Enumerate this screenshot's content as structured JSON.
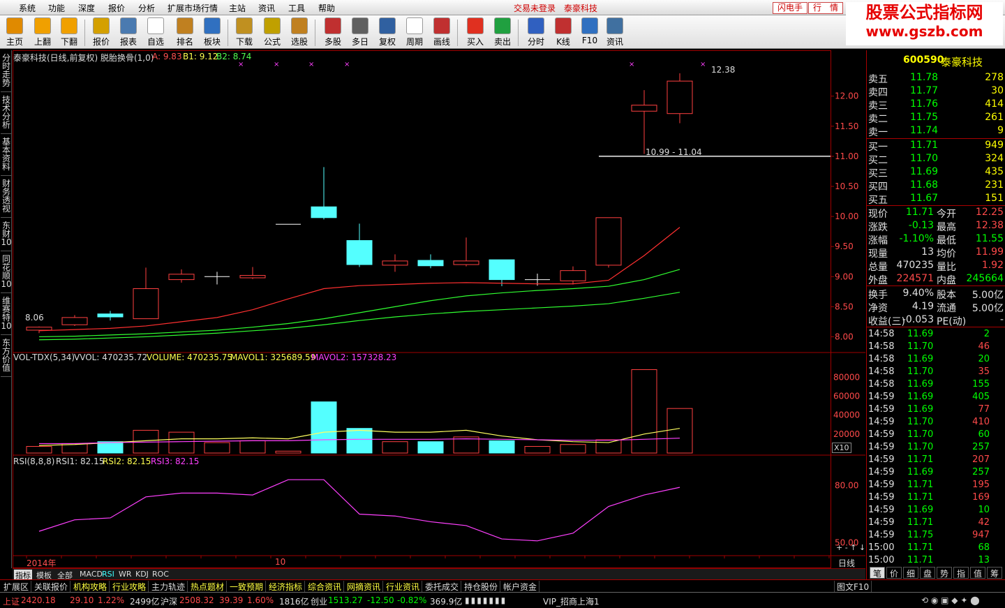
{
  "menu": {
    "items": [
      "系统",
      "功能",
      "深度",
      "报价",
      "分析",
      "扩展市场行情",
      "主站",
      "资讯",
      "工具",
      "帮助"
    ],
    "trade_status": "交易未登录",
    "stock_name": "泰豪科技",
    "btn_flash": "闪电手",
    "btn_quote": "行　情"
  },
  "logo": {
    "line1": "股票公式指标网",
    "line2": "www.gszb.com"
  },
  "toolbar": [
    {
      "label": "主页",
      "icon": "home-icon",
      "color": "#e08a00"
    },
    {
      "label": "上翻",
      "icon": "arrow-up-icon",
      "color": "#f0a000"
    },
    {
      "label": "下翻",
      "icon": "arrow-down-icon",
      "color": "#f0a000"
    },
    {
      "label": "报价",
      "icon": "yen-icon",
      "color": "#d4a000"
    },
    {
      "label": "报表",
      "icon": "report-icon",
      "color": "#4a7ab0"
    },
    {
      "label": "自选",
      "icon": "f6-icon",
      "color": "#ffffff"
    },
    {
      "label": "排名",
      "icon": "ranking-icon",
      "color": "#c08020"
    },
    {
      "label": "板块",
      "icon": "sector-icon",
      "color": "#3070c0"
    },
    {
      "label": "下载",
      "icon": "download-icon",
      "color": "#c09020"
    },
    {
      "label": "公式",
      "icon": "formula-icon",
      "color": "#c0a000"
    },
    {
      "label": "选股",
      "icon": "stock-pick-icon",
      "color": "#c08020"
    },
    {
      "label": "多股",
      "icon": "multi-stock-icon",
      "color": "#c03030"
    },
    {
      "label": "多日",
      "icon": "clock-icon",
      "color": "#606060"
    },
    {
      "label": "复权",
      "icon": "adjust-icon",
      "color": "#3060a0"
    },
    {
      "label": "周期",
      "icon": "f8-icon",
      "color": "#ffffff"
    },
    {
      "label": "画线",
      "icon": "draw-line-icon",
      "color": "#c03030"
    },
    {
      "label": "买入",
      "icon": "buy-icon",
      "color": "#e03020"
    },
    {
      "label": "卖出",
      "icon": "sell-icon",
      "color": "#20a040"
    },
    {
      "label": "分时",
      "icon": "intraday-icon",
      "color": "#3060c0"
    },
    {
      "label": "K线",
      "icon": "kline-icon",
      "color": "#c03030"
    },
    {
      "label": "F10",
      "icon": "f10-icon",
      "color": "#3070c0"
    },
    {
      "label": "资讯",
      "icon": "news-icon",
      "color": "#4070a0"
    }
  ],
  "left_tabs": [
    "分时走势",
    "技术分析",
    "基本资料",
    "财务透视",
    "东财10",
    "同花顺10",
    "维赛特10",
    "东方价值"
  ],
  "chart": {
    "title": "泰豪科技(日线,前复权) 脱胎换骨(1,0)",
    "ind_a": "A: 9.83",
    "ind_b1": "B1: 9.12",
    "ind_b2": "B2: 8.74",
    "high_label": "12.38",
    "low_label": "8.06",
    "gap_label": "10.99 - 11.04",
    "price_ticks": [
      "12.00",
      "11.50",
      "11.00",
      "10.50",
      "10.00",
      "9.50",
      "9.00",
      "8.50",
      "8.00"
    ],
    "vol_title": "VOL-TDX(5,34)",
    "vol_vvol": "VVOL: 470235.72",
    "vol_volume": "VOLUME: 470235.75",
    "vol_mavol1": "MAVOL1: 325689.59",
    "vol_mavol2": "MAVOL2: 157328.23",
    "vol_ticks": [
      "80000",
      "60000",
      "40000",
      "20000"
    ],
    "vol_unit": "X10",
    "rsi_title": "RSI(8,8,8)",
    "rsi1": "RSI1: 82.15",
    "rsi2": "RSI2: 82.15",
    "rsi3": "RSI3: 82.15",
    "rsi_ticks": [
      "80.00",
      "50.00"
    ],
    "date_year": "2014年",
    "date_month": "10",
    "period": "日线"
  },
  "chart_data": {
    "type": "candlestick",
    "candles": [
      {
        "o": 8.11,
        "c": 8.16,
        "h": 8.17,
        "l": 8.06
      },
      {
        "o": 8.2,
        "c": 8.32,
        "h": 8.36,
        "l": 8.18
      },
      {
        "o": 8.38,
        "c": 8.33,
        "h": 8.43,
        "l": 8.27
      },
      {
        "o": 8.3,
        "c": 8.8,
        "h": 9.15,
        "l": 8.3
      },
      {
        "o": 8.95,
        "c": 9.04,
        "h": 9.12,
        "l": 8.9
      },
      {
        "o": 9.0,
        "c": 9.0,
        "h": 9.08,
        "l": 8.87
      },
      {
        "o": 8.98,
        "c": 9.02,
        "h": 9.16,
        "l": 8.96
      },
      {
        "o": 9.87,
        "c": 9.87,
        "h": 9.87,
        "l": 9.87
      },
      {
        "o": 10.16,
        "c": 9.98,
        "h": 10.82,
        "l": 9.95
      },
      {
        "o": 9.6,
        "c": 9.2,
        "h": 9.88,
        "l": 9.16
      },
      {
        "o": 9.19,
        "c": 9.26,
        "h": 9.37,
        "l": 9.08
      },
      {
        "o": 9.27,
        "c": 9.18,
        "h": 9.37,
        "l": 9.14
      },
      {
        "o": 9.2,
        "c": 9.26,
        "h": 9.65,
        "l": 9.17
      },
      {
        "o": 9.28,
        "c": 8.95,
        "h": 9.28,
        "l": 8.84
      },
      {
        "o": 8.95,
        "c": 8.95,
        "h": 9.05,
        "l": 8.85
      },
      {
        "o": 8.93,
        "c": 9.1,
        "h": 9.17,
        "l": 8.87
      },
      {
        "o": 9.19,
        "c": 9.98,
        "h": 9.98,
        "l": 9.15
      },
      {
        "o": 11.75,
        "c": 11.85,
        "h": 12.1,
        "l": 11.04
      },
      {
        "o": 11.71,
        "c": 12.25,
        "h": 12.38,
        "l": 11.55
      }
    ],
    "volume": [
      7000,
      10000,
      12000,
      24000,
      22000,
      11000,
      13000,
      2000,
      54000,
      26000,
      12000,
      12000,
      17000,
      13000,
      7000,
      9000,
      14000,
      88000,
      47000
    ],
    "rsi": [
      56,
      62,
      63,
      74,
      76,
      76,
      75,
      83,
      83,
      65,
      64,
      61,
      59,
      52,
      51,
      55,
      69,
      75,
      79,
      82.15
    ],
    "y_range": [
      7.75,
      12.6
    ],
    "vol_range": [
      0,
      95000
    ],
    "rsi_range": [
      44,
      90
    ]
  },
  "quote": {
    "code": "600590",
    "name": "泰豪科技",
    "asks": [
      {
        "label": "卖五",
        "price": "11.78",
        "vol": "278"
      },
      {
        "label": "卖四",
        "price": "11.77",
        "vol": "30"
      },
      {
        "label": "卖三",
        "price": "11.76",
        "vol": "414"
      },
      {
        "label": "卖二",
        "price": "11.75",
        "vol": "261"
      },
      {
        "label": "卖一",
        "price": "11.74",
        "vol": "9"
      }
    ],
    "bids": [
      {
        "label": "买一",
        "price": "11.71",
        "vol": "949"
      },
      {
        "label": "买二",
        "price": "11.70",
        "vol": "324"
      },
      {
        "label": "买三",
        "price": "11.69",
        "vol": "435"
      },
      {
        "label": "买四",
        "price": "11.68",
        "vol": "231"
      },
      {
        "label": "买五",
        "price": "11.67",
        "vol": "151"
      }
    ],
    "stats": [
      {
        "l1": "现价",
        "v1": "11.71",
        "c1": "g",
        "l2": "今开",
        "v2": "12.25",
        "c2": "r"
      },
      {
        "l1": "涨跌",
        "v1": "-0.13",
        "c1": "g",
        "l2": "最高",
        "v2": "12.38",
        "c2": "r"
      },
      {
        "l1": "涨幅",
        "v1": "-1.10%",
        "c1": "g",
        "l2": "最低",
        "v2": "11.55",
        "c2": "g"
      },
      {
        "l1": "现量",
        "v1": "13",
        "c1": "w",
        "l2": "均价",
        "v2": "11.99",
        "c2": "r"
      },
      {
        "l1": "总量",
        "v1": "470235",
        "c1": "w",
        "l2": "量比",
        "v2": "1.92",
        "c2": "r"
      },
      {
        "l1": "外盘",
        "v1": "224571",
        "c1": "r",
        "l2": "内盘",
        "v2": "245664",
        "c2": "g"
      }
    ],
    "stats2": [
      {
        "l1": "换手",
        "v1": "9.40%",
        "c1": "w",
        "l2": "股本",
        "v2": "5.00亿",
        "c2": "w"
      },
      {
        "l1": "净资",
        "v1": "4.19",
        "c1": "w",
        "l2": "流通",
        "v2": "5.00亿",
        "c2": "w"
      },
      {
        "l1": "收益(三)",
        "v1": "-0.053",
        "c1": "w",
        "l2": "PE(动)",
        "v2": "-",
        "c2": "w"
      }
    ],
    "ticks": [
      {
        "t": "14:58",
        "p": "11.69",
        "v": "2",
        "vc": "g"
      },
      {
        "t": "14:58",
        "p": "11.70",
        "v": "46",
        "vc": "r"
      },
      {
        "t": "14:58",
        "p": "11.69",
        "v": "20",
        "vc": "g"
      },
      {
        "t": "14:58",
        "p": "11.70",
        "v": "35",
        "vc": "r"
      },
      {
        "t": "14:58",
        "p": "11.69",
        "v": "155",
        "vc": "g"
      },
      {
        "t": "14:59",
        "p": "11.69",
        "v": "405",
        "vc": "g"
      },
      {
        "t": "14:59",
        "p": "11.69",
        "v": "77",
        "vc": "r"
      },
      {
        "t": "14:59",
        "p": "11.70",
        "v": "410",
        "vc": "r"
      },
      {
        "t": "14:59",
        "p": "11.70",
        "v": "60",
        "vc": "g"
      },
      {
        "t": "14:59",
        "p": "11.70",
        "v": "257",
        "vc": "g"
      },
      {
        "t": "14:59",
        "p": "11.71",
        "v": "207",
        "vc": "r"
      },
      {
        "t": "14:59",
        "p": "11.69",
        "v": "257",
        "vc": "g"
      },
      {
        "t": "14:59",
        "p": "11.71",
        "v": "195",
        "vc": "r"
      },
      {
        "t": "14:59",
        "p": "11.71",
        "v": "169",
        "vc": "r"
      },
      {
        "t": "14:59",
        "p": "11.69",
        "v": "10",
        "vc": "g"
      },
      {
        "t": "14:59",
        "p": "11.71",
        "v": "42",
        "vc": "r"
      },
      {
        "t": "14:59",
        "p": "11.75",
        "v": "947",
        "vc": "r"
      },
      {
        "t": "15:00",
        "p": "11.71",
        "v": "68",
        "vc": "g"
      },
      {
        "t": "15:00",
        "p": "11.71",
        "v": "13",
        "vc": "g"
      }
    ],
    "tabs": [
      "笔",
      "价",
      "细",
      "盘",
      "势",
      "指",
      "值",
      "筹"
    ]
  },
  "bottom_tabs1": [
    "指标",
    "模板",
    "全部",
    "MACD",
    "RSI",
    "WR",
    "KDJ",
    "ROC"
  ],
  "bottom_tabs2": [
    {
      "label": "扩展区",
      "c": "w"
    },
    {
      "label": "关联报价",
      "c": "w"
    },
    {
      "label": "机构攻略",
      "c": "y"
    },
    {
      "label": "行业攻略",
      "c": "y"
    },
    {
      "label": "主力轨迹",
      "c": "w"
    },
    {
      "label": "热点题材",
      "c": "y"
    },
    {
      "label": "一致预期",
      "c": "y"
    },
    {
      "label": "经济指标",
      "c": "y"
    },
    {
      "label": "综合资讯",
      "c": "y"
    },
    {
      "label": "网摘资讯",
      "c": "y"
    },
    {
      "label": "行业资讯",
      "c": "y"
    },
    {
      "label": "委托成交",
      "c": "w"
    },
    {
      "label": "持仓股份",
      "c": "w"
    },
    {
      "label": "帐户资金",
      "c": "w"
    }
  ],
  "f10_label": "图文F10",
  "status": {
    "sh_label": "上证",
    "sh_val": "2420.18",
    "sh_chg": "29.10",
    "sh_pct": "1.22%",
    "sh_amt": "2499亿",
    "sz_label": "沪深",
    "sz_val": "2508.32",
    "sz_chg": "39.39",
    "sz_pct": "1.60%",
    "sz_amt": "1816亿",
    "cy_label": "创业",
    "cy_val": "1513.27",
    "cy_chg": "-12.50",
    "cy_pct": "-0.82%",
    "cy_amt": "369.9亿",
    "server": "VIP_招商上海1"
  }
}
